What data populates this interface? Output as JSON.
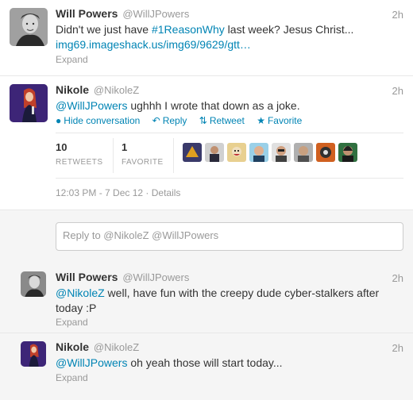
{
  "tweets": [
    {
      "name": "Will Powers",
      "handle": "@WillJPowers",
      "time": "2h",
      "text_before": "Didn't we just have ",
      "hashtag": "#1ReasonWhy",
      "text_after": " last week? Jesus Christ...",
      "link": "img69.imageshack.us/img69/9629/gtt…",
      "expand": "Expand"
    },
    {
      "name": "Nikole",
      "handle": "@NikoleZ",
      "time": "2h",
      "mention": "@WillJPowers",
      "text": " ughhh I wrote that down as a joke.",
      "actions": {
        "hide": "Hide conversation",
        "reply": "Reply",
        "retweet": "Retweet",
        "favorite": "Favorite"
      },
      "stats": {
        "retweets_count": "10",
        "retweets_label": "RETWEETS",
        "favorites_count": "1",
        "favorites_label": "FAVORITE"
      },
      "timestamp": "12:03 PM - 7 Dec 12",
      "details": "Details",
      "reply_placeholder": "Reply to @NikoleZ @WillJPowers"
    },
    {
      "name": "Will Powers",
      "handle": "@WillJPowers",
      "time": "2h",
      "mention": "@NikoleZ",
      "text": " well, have fun with the creepy dude cyber-stalkers after today :P",
      "expand": "Expand"
    },
    {
      "name": "Nikole",
      "handle": "@NikoleZ",
      "time": "2h",
      "mention": "@WillJPowers",
      "text": " oh yeah those will start today...",
      "expand": "Expand"
    }
  ],
  "icons": {
    "hide": "conversation-icon",
    "reply": "reply-arrow-icon",
    "retweet": "retweet-icon",
    "favorite": "star-icon"
  },
  "colors": {
    "link": "#0084b4",
    "muted": "#999999",
    "text": "#333333"
  }
}
